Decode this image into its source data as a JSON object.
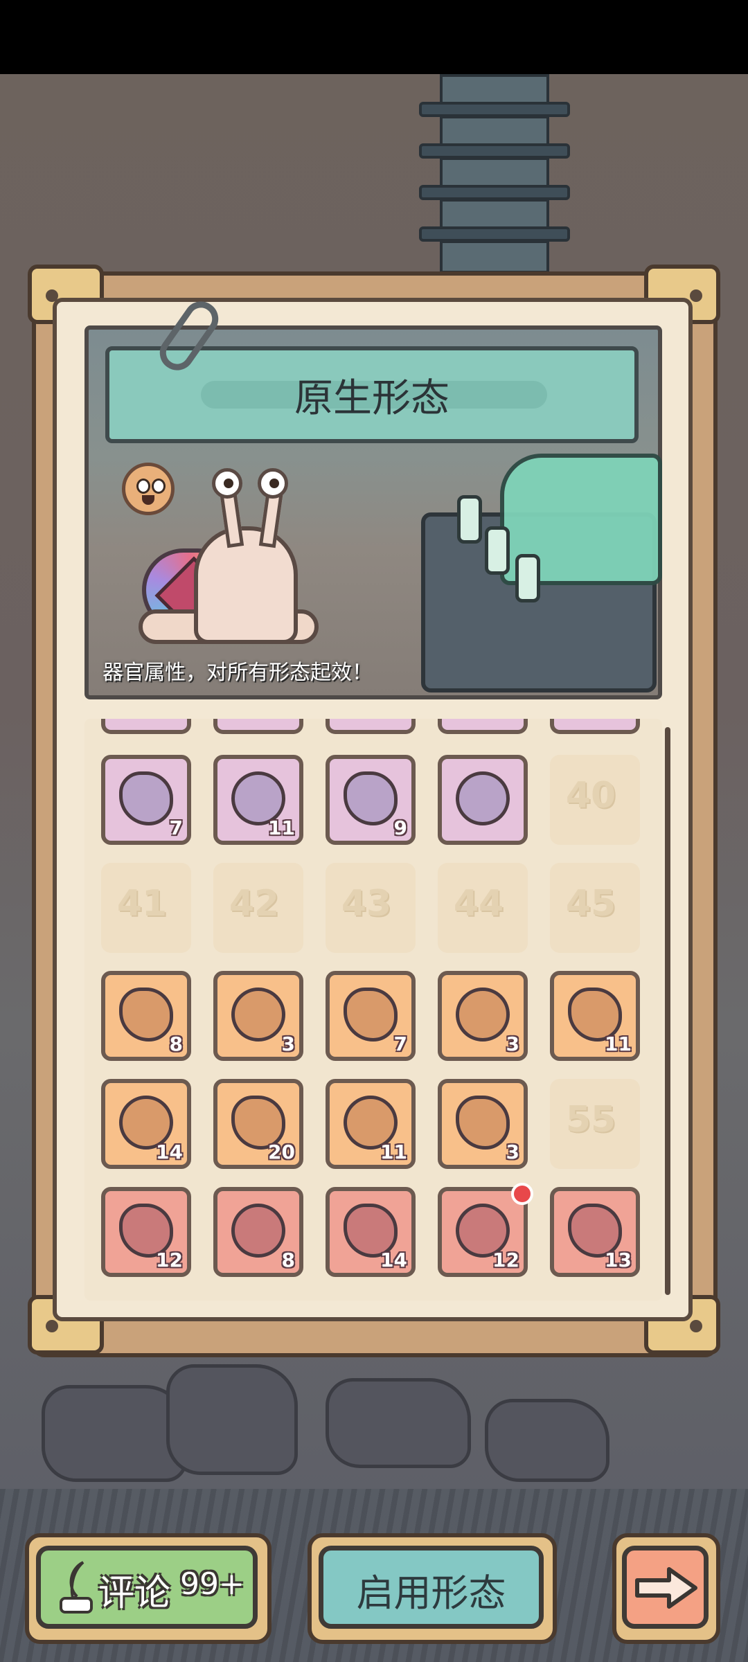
{
  "header": {
    "title": "原生形态"
  },
  "scene": {
    "caption": "器官属性，对所有形态起效！"
  },
  "organ_grid": {
    "rows": [
      [
        {
          "type": "organ",
          "color": "purple",
          "icon": "claw-organ-icon",
          "count": "7"
        },
        {
          "type": "organ",
          "color": "purple",
          "icon": "scale-organ-icon",
          "count": "11"
        },
        {
          "type": "organ",
          "color": "purple",
          "icon": "ribcage-organ-icon",
          "count": "9"
        },
        {
          "type": "organ",
          "color": "purple",
          "icon": "stinger-organ-icon",
          "count": ""
        },
        {
          "type": "locked",
          "label": "40"
        }
      ],
      [
        {
          "type": "locked",
          "label": "41"
        },
        {
          "type": "locked",
          "label": "42"
        },
        {
          "type": "locked",
          "label": "43"
        },
        {
          "type": "locked",
          "label": "44"
        },
        {
          "type": "locked",
          "label": "45"
        }
      ],
      [
        {
          "type": "organ",
          "color": "orange",
          "icon": "coral-organ-icon",
          "count": "8"
        },
        {
          "type": "organ",
          "color": "orange",
          "icon": "crystal-arm-organ-icon",
          "count": "3"
        },
        {
          "type": "organ",
          "color": "orange",
          "icon": "eye-disc-organ-icon",
          "count": "7"
        },
        {
          "type": "organ",
          "color": "orange",
          "icon": "horns-organ-icon",
          "count": "3"
        },
        {
          "type": "organ",
          "color": "orange",
          "icon": "heart-organ-icon",
          "count": "11"
        }
      ],
      [
        {
          "type": "organ",
          "color": "orange",
          "icon": "diamond-organ-icon",
          "count": "14"
        },
        {
          "type": "organ",
          "color": "orange",
          "icon": "muscle-arm-organ-icon",
          "count": "20"
        },
        {
          "type": "organ",
          "color": "orange",
          "icon": "brain-organ-icon",
          "count": "11"
        },
        {
          "type": "organ",
          "color": "orange",
          "icon": "spiked-crown-organ-icon",
          "count": "3"
        },
        {
          "type": "locked",
          "label": "55"
        }
      ],
      [
        {
          "type": "organ",
          "color": "red",
          "icon": "spine-organ-icon",
          "count": "12"
        },
        {
          "type": "organ",
          "color": "red",
          "icon": "eye-blob-organ-icon",
          "count": "8"
        },
        {
          "type": "organ",
          "color": "red",
          "icon": "eye-brain-organ-icon",
          "count": "14"
        },
        {
          "type": "organ",
          "color": "red",
          "icon": "spiral-shell-organ-icon",
          "count": "12",
          "badge": true
        },
        {
          "type": "organ",
          "color": "red",
          "icon": "flesh-heart-organ-icon",
          "count": "13"
        }
      ]
    ]
  },
  "buttons": {
    "comment_label": "评论",
    "comment_count": "99+",
    "enable_label": "启用形态",
    "next_icon": "arrow-right-icon"
  },
  "colors": {
    "purple_slot": "#e6c3dc",
    "orange_slot": "#f8c08a",
    "red_slot": "#f0a396",
    "locked_slot": "#efdfc4",
    "banner": "#8ac9bc",
    "comment_button": "#9ccf86",
    "enable_button": "#84c8c4",
    "next_button": "#f4a184"
  }
}
